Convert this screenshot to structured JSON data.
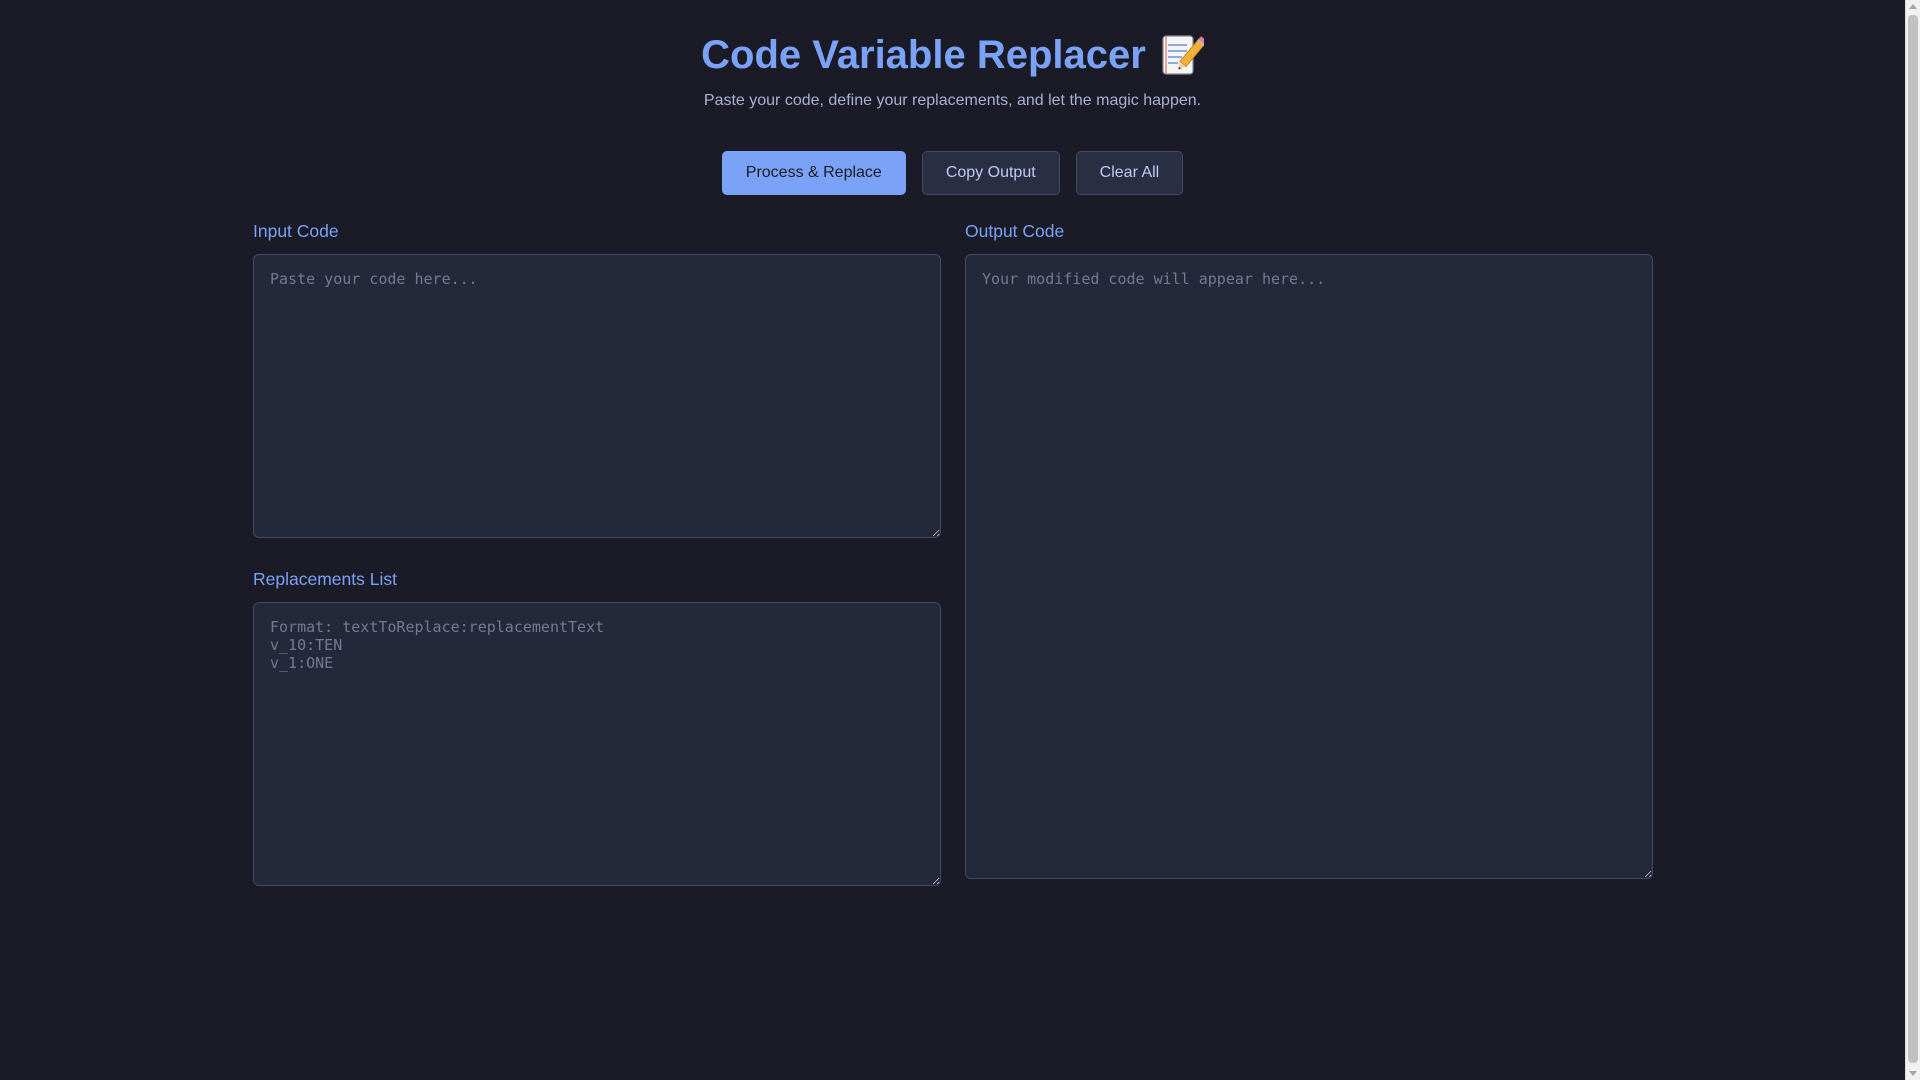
{
  "header": {
    "title": "Code Variable Replacer",
    "title_icon": "memo-pencil-icon",
    "subtitle": "Paste your code, define your replacements, and let the magic happen."
  },
  "actions": {
    "process_label": "Process & Replace",
    "copy_label": "Copy Output",
    "clear_label": "Clear All"
  },
  "input_panel": {
    "label": "Input Code",
    "value": "",
    "placeholder": "Paste your code here..."
  },
  "replacements_panel": {
    "label": "Replacements List",
    "value": "",
    "placeholder": "Format: textToReplace:replacementText\nv_10:TEN\nv_1:ONE"
  },
  "output_panel": {
    "label": "Output Code",
    "value": "",
    "placeholder": "Your modified code will appear here..."
  },
  "colors": {
    "background": "#1a1b26",
    "accent": "#7aa2f7",
    "panel": "#24283b",
    "border": "#414868",
    "muted_text": "#a9b1d6"
  }
}
